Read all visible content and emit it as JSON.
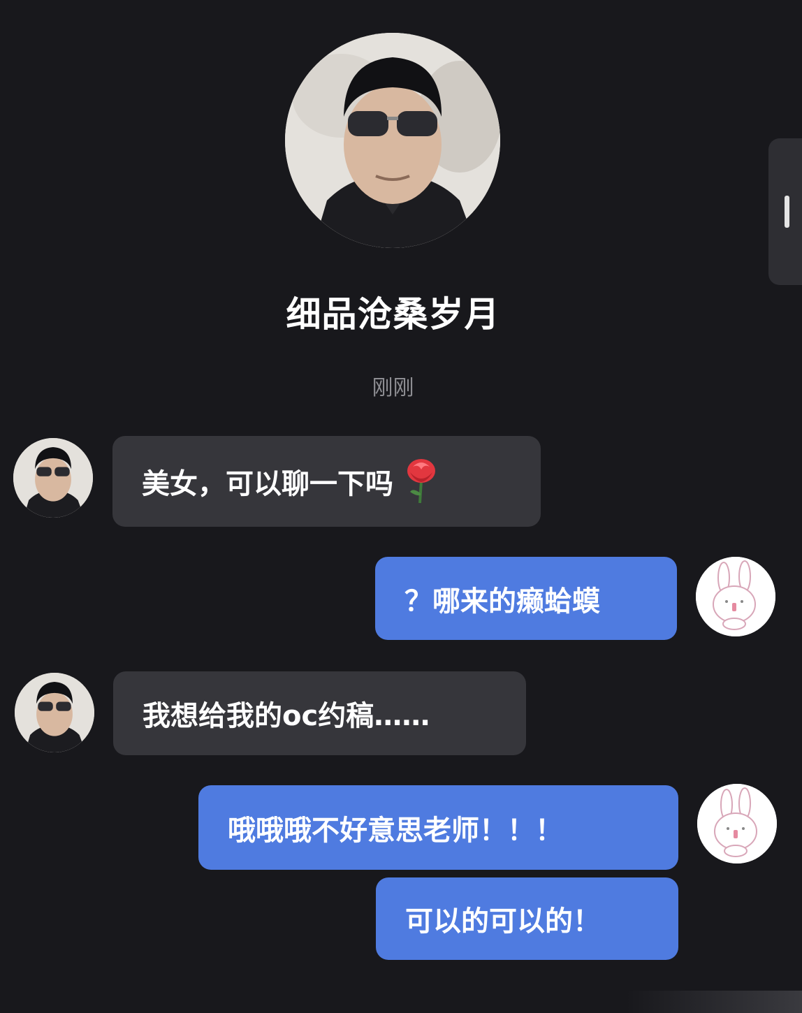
{
  "profile": {
    "name": "细品沧桑岁月",
    "timestamp": "刚刚"
  },
  "messages": [
    {
      "side": "in",
      "text": "美女，可以聊一下吗",
      "emoji": "rose-icon"
    },
    {
      "side": "out",
      "text": "？哪来的癞蛤蟆"
    },
    {
      "side": "in",
      "text": "我想给我的oc约稿……"
    },
    {
      "side": "out",
      "text": "哦哦哦不好意思老师！！！"
    },
    {
      "side": "out",
      "text": "可以的可以的！"
    }
  ],
  "colors": {
    "background": "#18181c",
    "incoming_bubble": "#36363b",
    "outgoing_bubble": "#4f7be0"
  }
}
